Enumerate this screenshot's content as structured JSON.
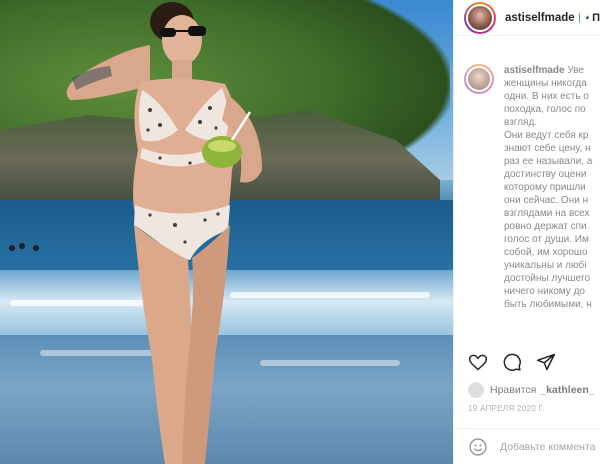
{
  "post": {
    "username": "astiselfmade",
    "follow_fragment": "• П",
    "photo_alt": "beach photo"
  },
  "caption": {
    "author": "astiselfmade",
    "lines": [
      "Уве",
      "женщины никогда",
      "одни. В них есть о",
      "походка, голос по",
      "взгляд.",
      "Они ведут себя кр",
      "знают себе цену, н",
      "раз ее называли, а",
      "достинству оцени",
      "которому пришли",
      "они сейчас. Они н",
      "взглядами на всех",
      "ровно держат спи",
      "голос от души. Им",
      "собой, им хорошо",
      "уникальны и любі",
      "достойны лучшего",
      "ничего никому до",
      "быть любимыми, н"
    ]
  },
  "likes": {
    "prefix": "Нравится",
    "user": "_kathleen_"
  },
  "date": "19 АПРЕЛЯ 2020 Г.",
  "comment": {
    "placeholder": "Добавьте коммента"
  }
}
